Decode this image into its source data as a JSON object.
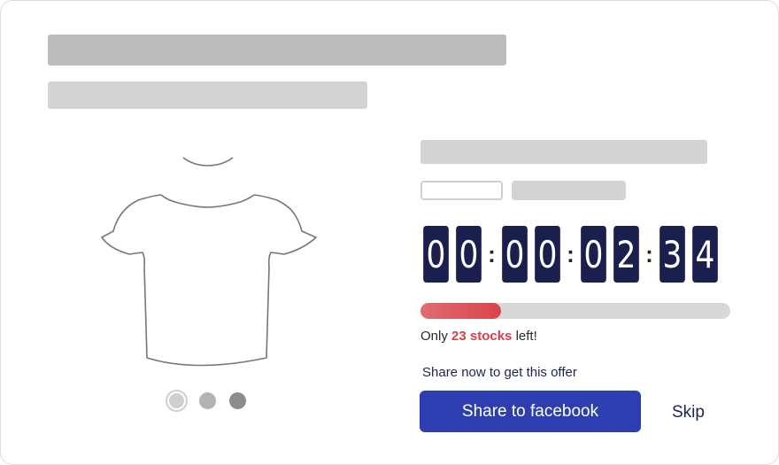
{
  "product": {
    "image_icon": "t-shirt-outline",
    "carousel": {
      "count": 3,
      "active_index": 0
    }
  },
  "countdown": {
    "digits": [
      "0",
      "0",
      "0",
      "0",
      "0",
      "2",
      "3",
      "4"
    ],
    "separator": ":"
  },
  "stock": {
    "progress_fraction": 0.26,
    "prefix": "Only ",
    "count_label": "23 stocks",
    "suffix": " left!",
    "bar_color": "#d9434b"
  },
  "offer": {
    "hint": "Share now to get this offer",
    "share_button_label": "Share to facebook",
    "skip_label": "Skip",
    "button_color": "#2d3fb0"
  },
  "colors": {
    "timer_bg": "#1b1f4e",
    "accent_red": "#d6404a",
    "text_navy": "#1c2452"
  }
}
